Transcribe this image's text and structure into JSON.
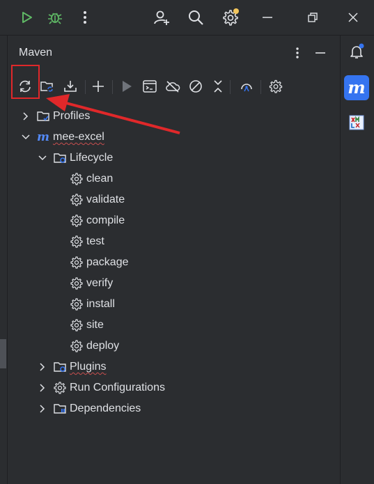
{
  "panel": {
    "title": "Maven"
  },
  "toolbar": {
    "tools": [
      "reload-all-maven-projects",
      "generate-sources-and-update-folders",
      "download-sources-and-docs",
      "add-maven-projects",
      "run-maven-build",
      "execute-maven-goal",
      "toggle-offline-mode",
      "toggle-skip-tests",
      "collapse-all",
      "show-dependencies",
      "build-tool-settings"
    ]
  },
  "tree": {
    "profiles": "Profiles",
    "project": "mee-excel",
    "lifecycle": "Lifecycle",
    "goals": [
      "clean",
      "validate",
      "compile",
      "test",
      "package",
      "verify",
      "install",
      "site",
      "deploy"
    ],
    "plugins": "Plugins",
    "run_configurations": "Run Configurations",
    "dependencies": "Dependencies"
  },
  "colors": {
    "accent_blue": "#3574f0",
    "arrow_red": "#e0282a",
    "run_green": "#5fb865",
    "notify_orange": "#f2c55c"
  }
}
